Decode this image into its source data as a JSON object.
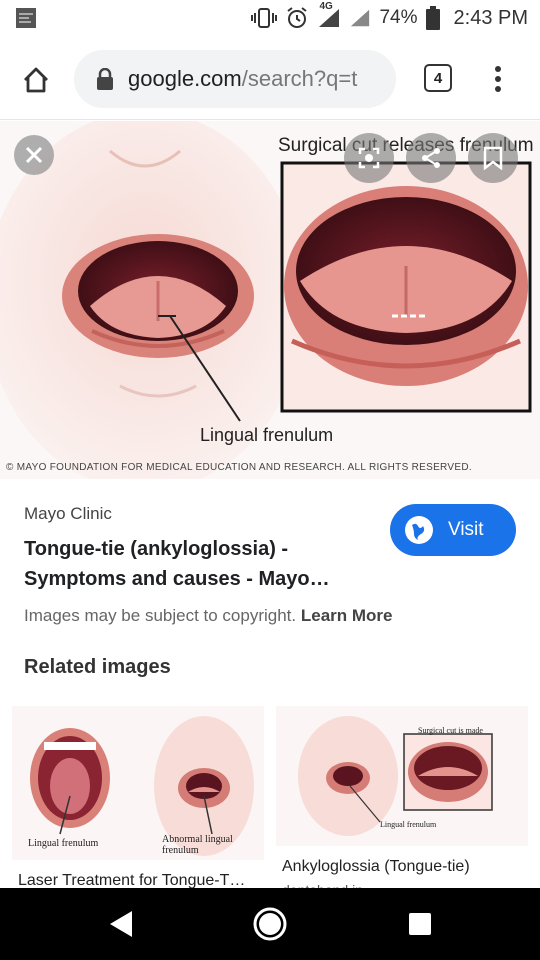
{
  "status_bar": {
    "network": "4G",
    "battery": "74%",
    "time": "2:43 PM",
    "icons": [
      "notification-icon",
      "vibrate-icon",
      "alarm-icon",
      "signal-icon",
      "signal-icon",
      "battery-icon"
    ]
  },
  "browser": {
    "url_domain": "google.com",
    "url_path": "/search?q=t",
    "tab_count": "4"
  },
  "image": {
    "caption_top": "Surgical cut releases frenulum",
    "label": "Lingual frenulum",
    "copyright": "© MAYO FOUNDATION FOR MEDICAL EDUCATION AND RESEARCH. ALL RIGHTS RESERVED."
  },
  "result": {
    "source": "Mayo Clinic",
    "title": "Tongue-tie (ankyloglossia) - Symptoms and causes - Mayo…",
    "visit_label": "Visit",
    "copyright_notice": "Images may be subject to copyright.",
    "learn_more": "Learn More"
  },
  "related": {
    "header": "Related images",
    "items": [
      {
        "caption": "Laser Treatment for Tongue-T…",
        "labels": [
          "Lingual frenulum",
          "Abnormal lingual frenulum"
        ]
      },
      {
        "caption": "Ankyloglossia (Tongue-tie)",
        "subcaption": "dentaband.in",
        "labels": [
          "Surgical cut is made",
          "Lingual frenulum"
        ]
      }
    ]
  },
  "colors": {
    "accent": "#1a73e8",
    "navbar": "#000000"
  }
}
